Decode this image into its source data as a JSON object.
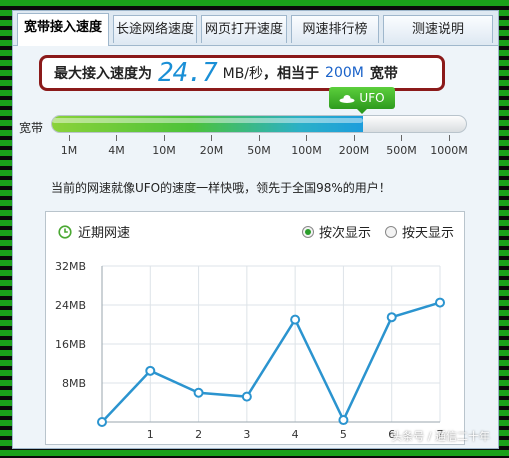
{
  "tabs": [
    {
      "label": "宽带接入速度",
      "active": true
    },
    {
      "label": "长途网络速度",
      "active": false
    },
    {
      "label": "网页打开速度",
      "active": false
    },
    {
      "label": "网速排行榜",
      "active": false
    },
    {
      "label": "测速说明",
      "active": false
    }
  ],
  "speed": {
    "prefix": "最大接入速度为",
    "value": "24.7",
    "unit": "MB/秒",
    "middle": "，相当于",
    "bandwidth": "200M",
    "suffix": "宽带"
  },
  "meter": {
    "label": "宽带",
    "badge": "UFO",
    "fill_fraction": 0.75,
    "scale": [
      "1M",
      "4M",
      "10M",
      "20M",
      "50M",
      "100M",
      "200M",
      "500M",
      "1000M"
    ]
  },
  "summary": "当前的网速就像UFO的速度一样快哦，领先于全国98%的用户！",
  "recent": {
    "title": "近期网速",
    "options": [
      {
        "label": "按次显示",
        "selected": true
      },
      {
        "label": "按天显示",
        "selected": false
      }
    ]
  },
  "watermark": "头条号 / 通信二十年",
  "chart_data": {
    "type": "line",
    "x": [
      0,
      1,
      2,
      3,
      4,
      5,
      6,
      7
    ],
    "x_tick_labels": [
      "1",
      "2",
      "3",
      "4",
      "5",
      "6",
      "7"
    ],
    "y_tick_labels": [
      "8MB",
      "16MB",
      "24MB",
      "32MB"
    ],
    "y_ticks": [
      8,
      16,
      24,
      32
    ],
    "ylim": [
      0,
      32
    ],
    "series": [
      {
        "values": [
          0,
          10.5,
          6,
          5.2,
          21,
          0.4,
          21.5,
          24.5
        ]
      }
    ],
    "colors": {
      "line": "#2b94cf"
    },
    "grid": true
  }
}
